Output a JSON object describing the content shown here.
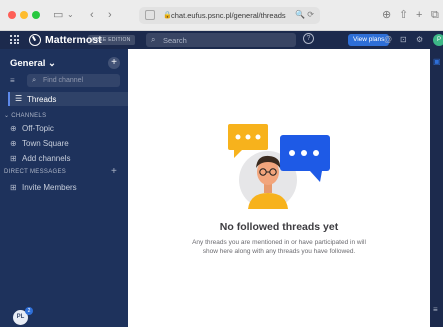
{
  "browser": {
    "url": "chat.eufus.psnc.pl/general/threads",
    "url_extra": "🔍 ⟳"
  },
  "topbar": {
    "brand": "Mattermost",
    "edition": "FREE EDITION",
    "search_placeholder": "Search",
    "help": "?",
    "view_plans": "View plans",
    "avatar_initial": "P"
  },
  "sidebar": {
    "team_name": "General",
    "team_chevron": "⌄",
    "add": "+",
    "find_placeholder": "Find channel",
    "threads_label": "Threads",
    "channels_header": "⌄ CHANNELS",
    "channels": [
      {
        "label": "Off-Topic",
        "icon": "globe-icon"
      },
      {
        "label": "Town Square",
        "icon": "globe-icon"
      },
      {
        "label": "Add channels",
        "icon": "plus-box-icon"
      }
    ],
    "dm_header": "DIRECT MESSAGES",
    "dm_items": [
      {
        "label": "Invite Members",
        "icon": "plus-box-icon"
      }
    ],
    "user_initials": "PL",
    "badge_count": "2"
  },
  "main": {
    "empty_title": "No followed threads yet",
    "empty_desc": "Any threads you are mentioned in or have participated in will show here along with any threads you have followed."
  },
  "colors": {
    "topbar": "#1c2a4d",
    "sidebar": "#1e325c",
    "accent": "#2e6fd8",
    "bubble_yellow": "#f7b21c",
    "bubble_blue": "#1e5ae6"
  }
}
